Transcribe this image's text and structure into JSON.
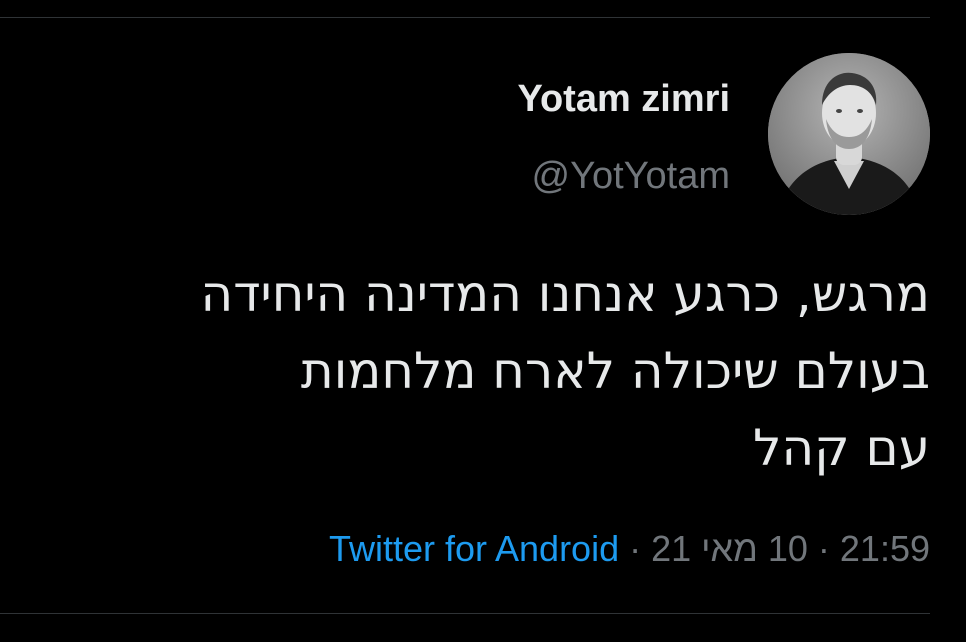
{
  "tweet": {
    "author": {
      "display_name": "Yotam zimri",
      "handle": "@YotYotam"
    },
    "text_lines": [
      "מרגש, כרגע אנחנו המדינה היחידה",
      "בעולם שיכולה לארח מלחמות",
      "עם קהל"
    ],
    "meta": {
      "time": "21:59",
      "date": "10 מאי 21",
      "separator": "·",
      "source": "Twitter for Android"
    }
  },
  "colors": {
    "background": "#000000",
    "text": "#e7e9ea",
    "secondary_text": "#71767b",
    "link": "#1d9bf0",
    "divider": "#2f3336"
  },
  "icons": {
    "avatar": "profile-photo-avatar"
  }
}
